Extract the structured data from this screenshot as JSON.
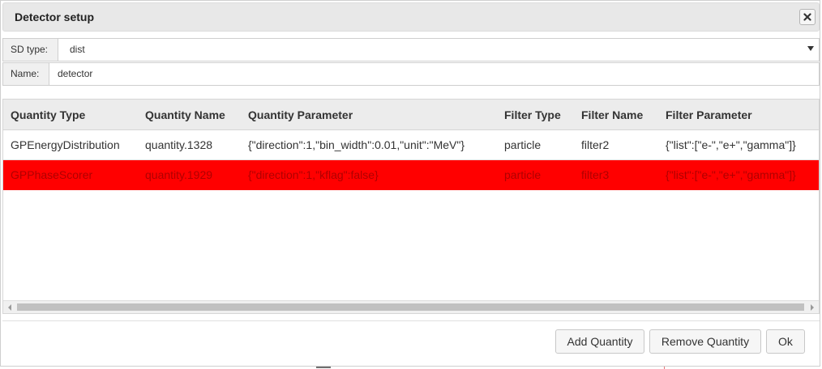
{
  "dialog": {
    "title": "Detector setup",
    "close_icon": "close-icon"
  },
  "form": {
    "sd_type_label": "SD type:",
    "sd_type_value": "dist",
    "name_label": "Name:",
    "name_value": "detector"
  },
  "table": {
    "columns": [
      "Quantity Type",
      "Quantity Name",
      "Quantity Parameter",
      "Filter Type",
      "Filter Name",
      "Filter Parameter"
    ],
    "rows": [
      {
        "quantity_type": "GPEnergyDistribution",
        "quantity_name": "quantity.1328",
        "quantity_parameter": "{\"direction\":1,\"bin_width\":0.01,\"unit\":\"MeV\"}",
        "filter_type": "particle",
        "filter_name": "filter2",
        "filter_parameter": "{\"list\":[\"e-\",\"e+\",\"gamma\"]}",
        "selected": false
      },
      {
        "quantity_type": "GPPhaseScorer",
        "quantity_name": "quantity.1929",
        "quantity_parameter": "{\"direction\":1,\"kflag\":false}",
        "filter_type": "particle",
        "filter_name": "filter3",
        "filter_parameter": "{\"list\":[\"e-\",\"e+\",\"gamma\"]}",
        "selected": true
      }
    ]
  },
  "buttons": {
    "add_quantity": "Add Quantity",
    "remove_quantity": "Remove Quantity",
    "ok": "Ok"
  },
  "colors": {
    "selected_row": "#ff0000",
    "header_bg": "#ececec"
  }
}
